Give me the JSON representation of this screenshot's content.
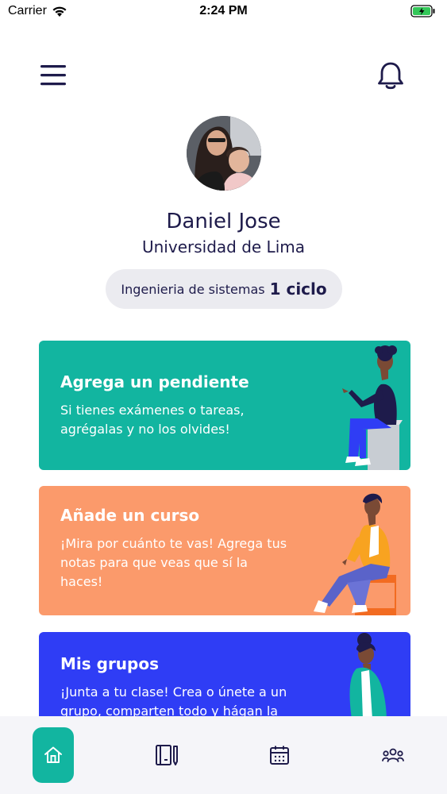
{
  "status_bar": {
    "carrier": "Carrier",
    "time": "2:24 PM",
    "battery_color": "#34c759"
  },
  "header": {
    "menu_icon": "hamburger-menu-icon",
    "notifications_icon": "bell-icon"
  },
  "profile": {
    "name": "Daniel Jose",
    "university": "Universidad de Lima",
    "career": "Ingenieria de sistemas",
    "cycle": "1 ciclo"
  },
  "cards": [
    {
      "title": "Agrega un pendiente",
      "description": "Si tienes exámenes o tareas, agrégalas y no los olvides!",
      "color": "#12b5a0"
    },
    {
      "title": "Añade un curso",
      "description": "¡Mira por cuánto te vas! Agrega tus notas para que veas que sí la haces!",
      "color": "#fb9a6b"
    },
    {
      "title": "Mis grupos",
      "description": "¡Junta a tu clase! Crea o únete a un grupo, comparten todo y hágan la",
      "color": "#2f3df5"
    }
  ],
  "bottom_nav": {
    "active_color": "#12b5a0",
    "items": [
      {
        "icon": "home-icon",
        "active": true
      },
      {
        "icon": "courses-icon",
        "active": false
      },
      {
        "icon": "calendar-icon",
        "active": false
      },
      {
        "icon": "groups-icon",
        "active": false
      }
    ]
  }
}
